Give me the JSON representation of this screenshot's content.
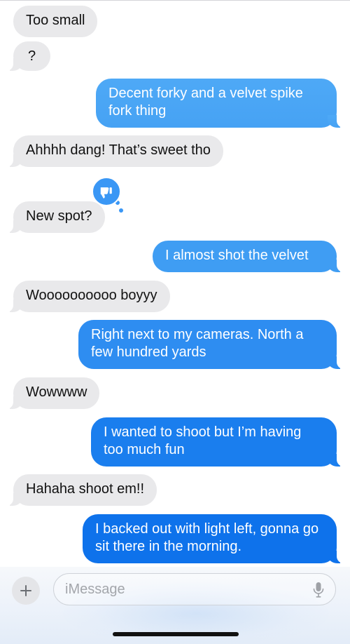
{
  "messages": [
    {
      "side": "received",
      "text": "Too small"
    },
    {
      "side": "received",
      "text": "?"
    },
    {
      "side": "sent",
      "text": "Decent forky and a velvet spike fork thing"
    },
    {
      "side": "received",
      "text": "Ahhhh dang! That’s sweet tho"
    },
    {
      "side": "received",
      "text": "New spot?",
      "reaction": "thumbs-down-icon"
    },
    {
      "side": "sent",
      "text": "I almost shot the velvet"
    },
    {
      "side": "received",
      "text": "Woooooooooo boyyy"
    },
    {
      "side": "sent",
      "text": "Right next to my cameras. North a few hundred yards"
    },
    {
      "side": "received",
      "text": "Wowwww"
    },
    {
      "side": "sent",
      "text": "I wanted to shoot but I’m having too much fun"
    },
    {
      "side": "received",
      "text": "Hahaha shoot em!!"
    },
    {
      "side": "sent",
      "text": "I backed out with light left, gonna go sit there in the morning."
    }
  ],
  "composer": {
    "placeholder": "iMessage",
    "plus_icon": "plus-icon",
    "mic_icon": "microphone-icon"
  },
  "colors": {
    "received_bubble": "#e9e9eb",
    "sent_gradient_top": "#4eacf7",
    "sent_gradient_bottom": "#0b6fe6",
    "tapback": "#3a97f5"
  }
}
